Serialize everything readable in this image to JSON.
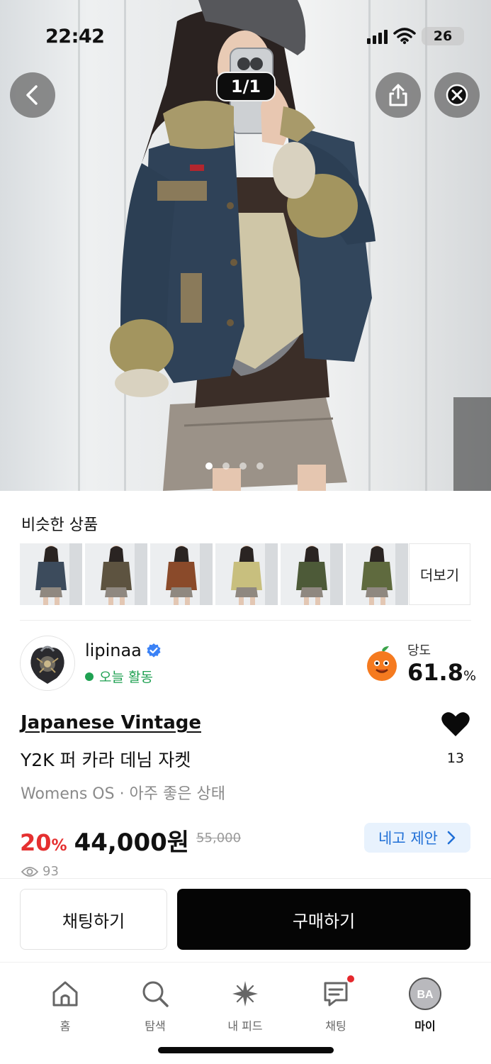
{
  "status_bar": {
    "time": "22:42",
    "battery": "26"
  },
  "gallery": {
    "counter": "1/1",
    "image_count": 4,
    "active_index": 0
  },
  "similar": {
    "title": "비슷한 상품",
    "more_label": "더보기",
    "thumb_colors": [
      "#3c4b5c",
      "#5d5340",
      "#8a4a2a",
      "#c8bf7e",
      "#4d5a38",
      "#5f6a3e"
    ]
  },
  "seller": {
    "name": "lipinaa",
    "activity": "오늘 활동",
    "sweetness_label": "당도",
    "sweetness_value": "61.8",
    "sweetness_unit": "%"
  },
  "product": {
    "brand": "Japanese Vintage",
    "title": "Y2K 퍼 카라 데님 자켓",
    "meta": "Womens OS · 아주 좋은 상태",
    "like_count": "13",
    "discount_value": "20",
    "discount_unit": "%",
    "price": "44,000원",
    "original_price": "55,000",
    "offer_label": "네고 제안",
    "views": "93"
  },
  "actions": {
    "chat_label": "채팅하기",
    "buy_label": "구매하기"
  },
  "tabs": [
    {
      "label": "홈",
      "icon": "home-icon"
    },
    {
      "label": "탐색",
      "icon": "search-icon"
    },
    {
      "label": "내 피드",
      "icon": "sparkle-icon"
    },
    {
      "label": "채팅",
      "icon": "chat-icon"
    },
    {
      "label": "마이",
      "icon": "profile-icon",
      "avatar_text": "BA"
    }
  ],
  "colors": {
    "accent_red": "#e53030",
    "offer_blue": "#1f6fd6",
    "active_green": "#1fa152",
    "verified_blue": "#3b82f6"
  }
}
